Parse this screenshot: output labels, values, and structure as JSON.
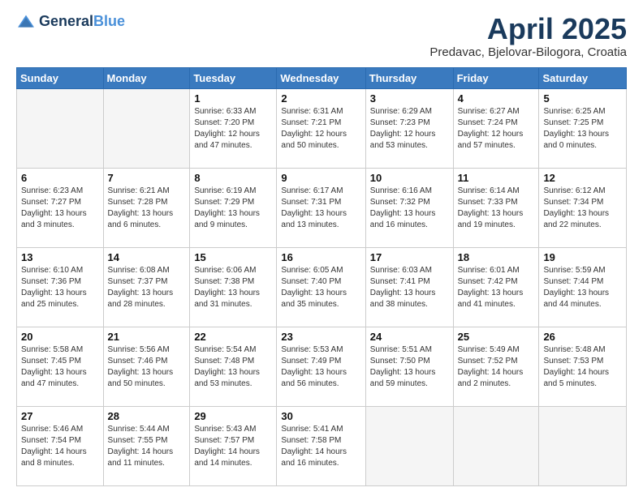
{
  "logo": {
    "general": "General",
    "blue": "Blue"
  },
  "header": {
    "month": "April 2025",
    "location": "Predavac, Bjelovar-Bilogora, Croatia"
  },
  "weekdays": [
    "Sunday",
    "Monday",
    "Tuesday",
    "Wednesday",
    "Thursday",
    "Friday",
    "Saturday"
  ],
  "weeks": [
    [
      {
        "day": "",
        "sunrise": "",
        "sunset": "",
        "daylight": ""
      },
      {
        "day": "",
        "sunrise": "",
        "sunset": "",
        "daylight": ""
      },
      {
        "day": "1",
        "sunrise": "Sunrise: 6:33 AM",
        "sunset": "Sunset: 7:20 PM",
        "daylight": "Daylight: 12 hours and 47 minutes."
      },
      {
        "day": "2",
        "sunrise": "Sunrise: 6:31 AM",
        "sunset": "Sunset: 7:21 PM",
        "daylight": "Daylight: 12 hours and 50 minutes."
      },
      {
        "day": "3",
        "sunrise": "Sunrise: 6:29 AM",
        "sunset": "Sunset: 7:23 PM",
        "daylight": "Daylight: 12 hours and 53 minutes."
      },
      {
        "day": "4",
        "sunrise": "Sunrise: 6:27 AM",
        "sunset": "Sunset: 7:24 PM",
        "daylight": "Daylight: 12 hours and 57 minutes."
      },
      {
        "day": "5",
        "sunrise": "Sunrise: 6:25 AM",
        "sunset": "Sunset: 7:25 PM",
        "daylight": "Daylight: 13 hours and 0 minutes."
      }
    ],
    [
      {
        "day": "6",
        "sunrise": "Sunrise: 6:23 AM",
        "sunset": "Sunset: 7:27 PM",
        "daylight": "Daylight: 13 hours and 3 minutes."
      },
      {
        "day": "7",
        "sunrise": "Sunrise: 6:21 AM",
        "sunset": "Sunset: 7:28 PM",
        "daylight": "Daylight: 13 hours and 6 minutes."
      },
      {
        "day": "8",
        "sunrise": "Sunrise: 6:19 AM",
        "sunset": "Sunset: 7:29 PM",
        "daylight": "Daylight: 13 hours and 9 minutes."
      },
      {
        "day": "9",
        "sunrise": "Sunrise: 6:17 AM",
        "sunset": "Sunset: 7:31 PM",
        "daylight": "Daylight: 13 hours and 13 minutes."
      },
      {
        "day": "10",
        "sunrise": "Sunrise: 6:16 AM",
        "sunset": "Sunset: 7:32 PM",
        "daylight": "Daylight: 13 hours and 16 minutes."
      },
      {
        "day": "11",
        "sunrise": "Sunrise: 6:14 AM",
        "sunset": "Sunset: 7:33 PM",
        "daylight": "Daylight: 13 hours and 19 minutes."
      },
      {
        "day": "12",
        "sunrise": "Sunrise: 6:12 AM",
        "sunset": "Sunset: 7:34 PM",
        "daylight": "Daylight: 13 hours and 22 minutes."
      }
    ],
    [
      {
        "day": "13",
        "sunrise": "Sunrise: 6:10 AM",
        "sunset": "Sunset: 7:36 PM",
        "daylight": "Daylight: 13 hours and 25 minutes."
      },
      {
        "day": "14",
        "sunrise": "Sunrise: 6:08 AM",
        "sunset": "Sunset: 7:37 PM",
        "daylight": "Daylight: 13 hours and 28 minutes."
      },
      {
        "day": "15",
        "sunrise": "Sunrise: 6:06 AM",
        "sunset": "Sunset: 7:38 PM",
        "daylight": "Daylight: 13 hours and 31 minutes."
      },
      {
        "day": "16",
        "sunrise": "Sunrise: 6:05 AM",
        "sunset": "Sunset: 7:40 PM",
        "daylight": "Daylight: 13 hours and 35 minutes."
      },
      {
        "day": "17",
        "sunrise": "Sunrise: 6:03 AM",
        "sunset": "Sunset: 7:41 PM",
        "daylight": "Daylight: 13 hours and 38 minutes."
      },
      {
        "day": "18",
        "sunrise": "Sunrise: 6:01 AM",
        "sunset": "Sunset: 7:42 PM",
        "daylight": "Daylight: 13 hours and 41 minutes."
      },
      {
        "day": "19",
        "sunrise": "Sunrise: 5:59 AM",
        "sunset": "Sunset: 7:44 PM",
        "daylight": "Daylight: 13 hours and 44 minutes."
      }
    ],
    [
      {
        "day": "20",
        "sunrise": "Sunrise: 5:58 AM",
        "sunset": "Sunset: 7:45 PM",
        "daylight": "Daylight: 13 hours and 47 minutes."
      },
      {
        "day": "21",
        "sunrise": "Sunrise: 5:56 AM",
        "sunset": "Sunset: 7:46 PM",
        "daylight": "Daylight: 13 hours and 50 minutes."
      },
      {
        "day": "22",
        "sunrise": "Sunrise: 5:54 AM",
        "sunset": "Sunset: 7:48 PM",
        "daylight": "Daylight: 13 hours and 53 minutes."
      },
      {
        "day": "23",
        "sunrise": "Sunrise: 5:53 AM",
        "sunset": "Sunset: 7:49 PM",
        "daylight": "Daylight: 13 hours and 56 minutes."
      },
      {
        "day": "24",
        "sunrise": "Sunrise: 5:51 AM",
        "sunset": "Sunset: 7:50 PM",
        "daylight": "Daylight: 13 hours and 59 minutes."
      },
      {
        "day": "25",
        "sunrise": "Sunrise: 5:49 AM",
        "sunset": "Sunset: 7:52 PM",
        "daylight": "Daylight: 14 hours and 2 minutes."
      },
      {
        "day": "26",
        "sunrise": "Sunrise: 5:48 AM",
        "sunset": "Sunset: 7:53 PM",
        "daylight": "Daylight: 14 hours and 5 minutes."
      }
    ],
    [
      {
        "day": "27",
        "sunrise": "Sunrise: 5:46 AM",
        "sunset": "Sunset: 7:54 PM",
        "daylight": "Daylight: 14 hours and 8 minutes."
      },
      {
        "day": "28",
        "sunrise": "Sunrise: 5:44 AM",
        "sunset": "Sunset: 7:55 PM",
        "daylight": "Daylight: 14 hours and 11 minutes."
      },
      {
        "day": "29",
        "sunrise": "Sunrise: 5:43 AM",
        "sunset": "Sunset: 7:57 PM",
        "daylight": "Daylight: 14 hours and 14 minutes."
      },
      {
        "day": "30",
        "sunrise": "Sunrise: 5:41 AM",
        "sunset": "Sunset: 7:58 PM",
        "daylight": "Daylight: 14 hours and 16 minutes."
      },
      {
        "day": "",
        "sunrise": "",
        "sunset": "",
        "daylight": ""
      },
      {
        "day": "",
        "sunrise": "",
        "sunset": "",
        "daylight": ""
      },
      {
        "day": "",
        "sunrise": "",
        "sunset": "",
        "daylight": ""
      }
    ]
  ]
}
